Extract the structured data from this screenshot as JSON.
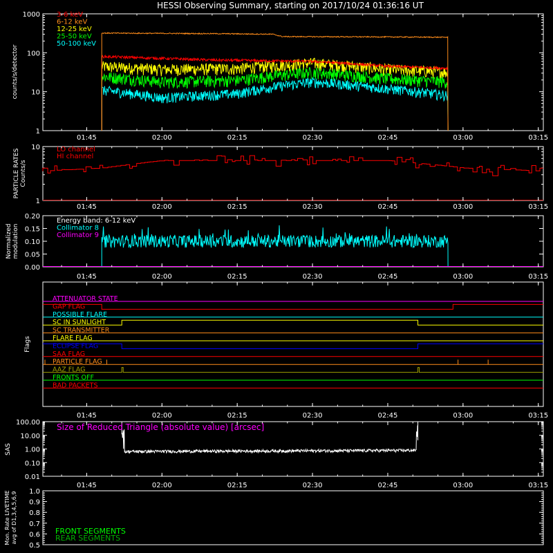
{
  "title": "HESSI Observing Summary, starting on 2017/10/24 01:36:16 UT",
  "time_ticks": [
    "01:45",
    "02:00",
    "02:15",
    "02:30",
    "02:45",
    "03:00",
    "03:15"
  ],
  "colors": {
    "axis": "#ffffff",
    "red": "#ff0000",
    "orange": "#ff8c1a",
    "yellow": "#ffff00",
    "green": "#00ff00",
    "cyan": "#00ffff",
    "magenta": "#ff00ff",
    "blue": "#0000ff",
    "olive": "#a0a000",
    "dkgreen": "#00b000"
  },
  "panels": {
    "rates": {
      "ylabel": "counts/s/detector",
      "y_ticks": [
        "1000",
        "100",
        "10",
        "1"
      ],
      "legend": [
        {
          "label": "3-6 keV",
          "color": "#ff0000"
        },
        {
          "label": "6-12 keV",
          "color": "#ff8c1a"
        },
        {
          "label": "12-25 keV",
          "color": "#ffff00"
        },
        {
          "label": "25-50 keV",
          "color": "#00ff00"
        },
        {
          "label": "50-100 keV",
          "color": "#00ffff"
        }
      ]
    },
    "particle": {
      "ylabel_1": "PARTICLE RATES",
      "ylabel_2": "Counts/s",
      "y_ticks": [
        "10",
        "1"
      ],
      "legend": [
        {
          "label": "LO channel",
          "color": "#ff0000"
        },
        {
          "label": "HI channel",
          "color": "#ff0000"
        }
      ]
    },
    "modulation": {
      "ylabel_1": "Normalized",
      "ylabel_2": "modulation",
      "y_ticks": [
        "0.20",
        "0.15",
        "0.10",
        "0.05",
        "0.00"
      ],
      "legend": [
        {
          "label": "Energy band: 6-12 keV",
          "color": "#ffffff"
        },
        {
          "label": "Collimator 8",
          "color": "#00ffff"
        },
        {
          "label": "Collimator 9",
          "color": "#ff00ff"
        }
      ]
    },
    "flags": {
      "ylabel": "Flags",
      "rows": [
        {
          "label": "ATTENUATOR STATE",
          "color": "#ff00ff"
        },
        {
          "label": "GAP FLAG",
          "color": "#ff0000"
        },
        {
          "label": "POSSIBLE FLARE",
          "color": "#00ffff"
        },
        {
          "label": "SC IN SUNLIGHT",
          "color": "#ffff00"
        },
        {
          "label": "SC TRANSMITTER",
          "color": "#ff8c1a"
        },
        {
          "label": "FLARE FLAG",
          "color": "#ffff00"
        },
        {
          "label": "ECLIPSE FLAG",
          "color": "#0000ff"
        },
        {
          "label": "SAA FLAG",
          "color": "#ff0000"
        },
        {
          "label": "PARTICLE FLAG",
          "color": "#ff8c1a"
        },
        {
          "label": "AAZ FLAG",
          "color": "#a0a000"
        },
        {
          "label": "FRONTS OFF",
          "color": "#00ff00"
        },
        {
          "label": "BAD PACKETS",
          "color": "#ff0000"
        }
      ]
    },
    "sas": {
      "ylabel": "SAS",
      "y_ticks": [
        "100.00",
        "10.00",
        "1.00",
        "0.10",
        "0.01"
      ],
      "annotation": "Size of Reduced Triangle (absolute value) [arcsec]",
      "annotation_color": "#ff00ff"
    },
    "livetime": {
      "ylabel_1": "Mon. Rate LIVETIME",
      "ylabel_2": "avg of D1,3,4,5,6,9",
      "y_ticks": [
        "1.0",
        "0.9",
        "0.8",
        "0.7",
        "0.6",
        "0.5"
      ],
      "legend": [
        {
          "label": "FRONT SEGMENTS",
          "color": "#00ff00"
        },
        {
          "label": "REAR SEGMENTS",
          "color": "#00b000"
        }
      ]
    }
  },
  "chart_data": [
    {
      "type": "line",
      "title": "HESSI Observing Summary, starting on 2017/10/24 01:36:16 UT",
      "ylabel": "counts/s/detector",
      "yscale": "log",
      "ylim": [
        1,
        1000
      ],
      "x_unit": "UT",
      "xlim": [
        "01:36:16",
        "03:16:00"
      ],
      "series": [
        {
          "name": "3-6 keV",
          "x": [
            "01:48",
            "01:48",
            "02:10",
            "02:30",
            "02:45",
            "02:57",
            "02:57"
          ],
          "values": [
            1,
            80,
            65,
            60,
            45,
            40,
            1
          ]
        },
        {
          "name": "6-12 keV",
          "x": [
            "01:48",
            "01:48",
            "02:10",
            "02:22",
            "02:24",
            "02:45",
            "02:57",
            "02:57"
          ],
          "values": [
            1,
            320,
            310,
            300,
            260,
            255,
            250,
            1
          ]
        },
        {
          "name": "12-25 keV",
          "x": [
            "01:48",
            "01:48",
            "02:00",
            "02:15",
            "02:30",
            "02:45",
            "02:57",
            "02:57"
          ],
          "values": [
            1,
            45,
            38,
            40,
            55,
            38,
            32,
            1
          ]
        },
        {
          "name": "25-50 keV",
          "x": [
            "01:48",
            "01:48",
            "02:00",
            "02:15",
            "02:30",
            "02:45",
            "02:57",
            "02:57"
          ],
          "values": [
            1,
            25,
            18,
            20,
            32,
            22,
            18,
            1
          ]
        },
        {
          "name": "50-100 keV",
          "x": [
            "01:48",
            "01:48",
            "02:00",
            "02:15",
            "02:30",
            "02:45",
            "02:57",
            "02:57"
          ],
          "values": [
            1,
            11,
            7,
            9,
            18,
            12,
            8,
            1
          ]
        }
      ]
    },
    {
      "type": "line",
      "ylabel": "PARTICLE RATES Counts/s",
      "yscale": "log",
      "ylim": [
        1,
        10
      ],
      "series": [
        {
          "name": "LO channel",
          "x": [
            "01:36",
            "01:48",
            "02:00",
            "02:15",
            "02:30",
            "02:45",
            "03:00",
            "03:16"
          ],
          "values": [
            3.5,
            4,
            5.5,
            5.5,
            5.5,
            5.5,
            4,
            3.5
          ]
        }
      ]
    },
    {
      "type": "line",
      "ylabel": "Normalized modulation",
      "ylim": [
        0,
        0.2
      ],
      "series": [
        {
          "name": "Collimator 8",
          "x": [
            "01:48",
            "01:48",
            "02:15",
            "02:45",
            "02:57",
            "02:57"
          ],
          "values": [
            0,
            0.1,
            0.1,
            0.1,
            0.1,
            0
          ]
        },
        {
          "name": "Collimator 9",
          "x": [
            "01:36",
            "03:16"
          ],
          "values": [
            0,
            0
          ]
        }
      ]
    },
    {
      "type": "line",
      "ylabel": "SAS",
      "yscale": "log",
      "ylim": [
        0.01,
        100
      ],
      "series": [
        {
          "name": "Size of Reduced Triangle (absolute value) [arcsec]",
          "x": [
            "01:52",
            "01:52",
            "02:00",
            "02:30",
            "02:51",
            "02:51"
          ],
          "values": [
            100,
            0.6,
            0.7,
            0.75,
            0.8,
            100
          ]
        }
      ]
    },
    {
      "type": "line",
      "ylabel": "Mon. Rate LIVETIME avg of D1,3,4,5,6,9",
      "ylim": [
        0.5,
        1.0
      ],
      "series": [
        {
          "name": "FRONT SEGMENTS",
          "x": [],
          "values": []
        },
        {
          "name": "REAR SEGMENTS",
          "x": [],
          "values": []
        }
      ]
    }
  ]
}
